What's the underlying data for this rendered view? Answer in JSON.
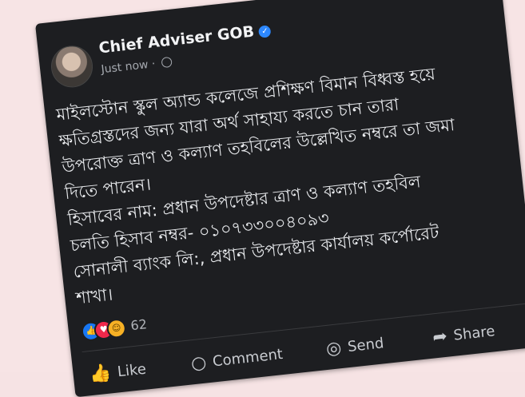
{
  "post": {
    "author": "Chief Adviser GOB",
    "time": "Just now",
    "separator": "·",
    "body_lines": [
      "মাইলস্টোন স্কুল অ্যান্ড কলেজে প্রশিক্ষণ বিমান বিধ্বস্ত হয়ে",
      "ক্ষতিগ্রস্তদের জন্য যারা অর্থ সাহায্য করতে চান তারা",
      "উপরোক্ত ত্রাণ ও কল্যাণ তহবিলের উল্লেখিত নম্বরে তা জমা",
      "দিতে পারেন।",
      "হিসাবের নাম: প্রধান উপদেষ্টার ত্রাণ ও কল্যাণ তহবিল",
      "চলতি হিসাব নম্বর- ০১০৭৩৩০০৪০৯৩",
      "সোনালী ব্যাংক লি:, প্রধান উপদেষ্টার কার্যালয় কর্পোরেট",
      "শাখা।"
    ],
    "reaction_count": "62"
  },
  "actions": {
    "like": "Like",
    "comment": "Comment",
    "send": "Send",
    "share": "Share"
  },
  "colors": {
    "card_bg": "#1d1e21",
    "page_bg": "#f7e4e5",
    "verified": "#2d88ff"
  },
  "icons": [
    "more-icon",
    "close-icon",
    "verified-icon",
    "globe-icon",
    "like-reaction-icon",
    "love-reaction-icon",
    "haha-reaction-icon",
    "like-icon",
    "comment-icon",
    "send-icon",
    "share-icon"
  ]
}
